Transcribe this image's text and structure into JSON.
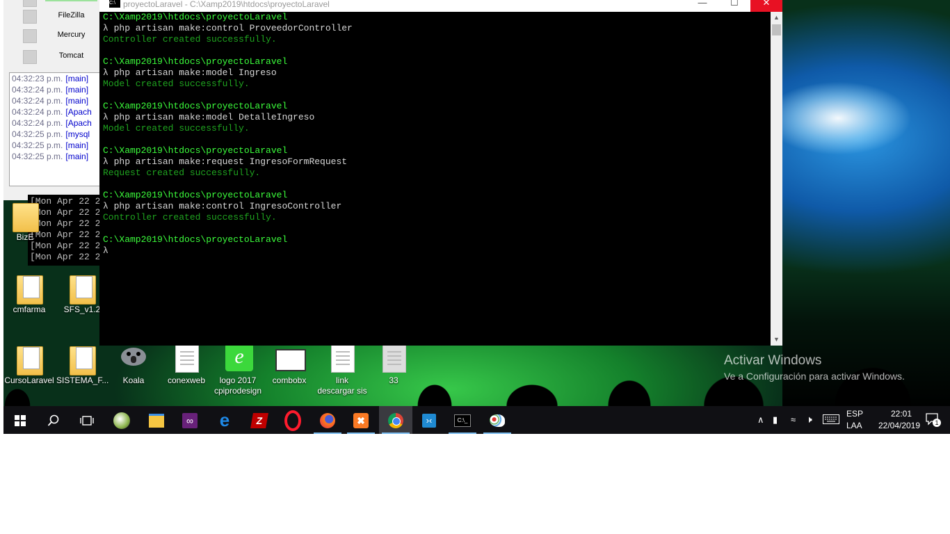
{
  "xampp": {
    "services": [
      "FileZilla",
      "Mercury",
      "Tomcat"
    ],
    "log": [
      {
        "time": "04:32:23 p.m.",
        "tag": "[main]"
      },
      {
        "time": "04:32:24 p.m.",
        "tag": "[main]"
      },
      {
        "time": "04:32:24 p.m.",
        "tag": "[main]"
      },
      {
        "time": "04:32:24 p.m.",
        "tag": "[Apach"
      },
      {
        "time": "04:32:24 p.m.",
        "tag": "[Apach"
      },
      {
        "time": "04:32:25 p.m.",
        "tag": "[mysql"
      },
      {
        "time": "04:32:25 p.m.",
        "tag": "[main]"
      },
      {
        "time": "04:32:25 p.m.",
        "tag": "[main]"
      }
    ]
  },
  "apache_log": [
    "[Mon Apr 22 2",
    "[Mon Apr 22 2",
    "[Mon Apr 22 2",
    "[Mon Apr 22 2",
    "[Mon Apr 22 2",
    "[Mon Apr 22 2"
  ],
  "terminal": {
    "title": "proyectoLaravel -  C:\\Xamp2019\\htdocs\\proyectoLaravel",
    "lines": [
      {
        "kind": "path",
        "text": "C:\\Xamp2019\\htdocs\\proyectoLaravel"
      },
      {
        "kind": "cmd",
        "text": "λ php artisan make:control ProveedorController"
      },
      {
        "kind": "ok",
        "text": "Controller created successfully."
      },
      {
        "kind": "blank",
        "text": ""
      },
      {
        "kind": "path",
        "text": "C:\\Xamp2019\\htdocs\\proyectoLaravel"
      },
      {
        "kind": "cmd",
        "text": "λ php artisan make:model Ingreso"
      },
      {
        "kind": "ok",
        "text": "Model created successfully."
      },
      {
        "kind": "blank",
        "text": ""
      },
      {
        "kind": "path",
        "text": "C:\\Xamp2019\\htdocs\\proyectoLaravel"
      },
      {
        "kind": "cmd",
        "text": "λ php artisan make:model DetalleIngreso"
      },
      {
        "kind": "ok",
        "text": "Model created successfully."
      },
      {
        "kind": "blank",
        "text": ""
      },
      {
        "kind": "path",
        "text": "C:\\Xamp2019\\htdocs\\proyectoLaravel"
      },
      {
        "kind": "cmd",
        "text": "λ php artisan make:request IngresoFormRequest"
      },
      {
        "kind": "ok",
        "text": "Request created successfully."
      },
      {
        "kind": "blank",
        "text": ""
      },
      {
        "kind": "path",
        "text": "C:\\Xamp2019\\htdocs\\proyectoLaravel"
      },
      {
        "kind": "cmd",
        "text": "λ php artisan make:control IngresoController"
      },
      {
        "kind": "ok",
        "text": "Controller created successfully."
      },
      {
        "kind": "blank",
        "text": ""
      },
      {
        "kind": "path",
        "text": "C:\\Xamp2019\\htdocs\\proyectoLaravel"
      },
      {
        "kind": "cmd",
        "text": "λ"
      }
    ]
  },
  "desktop_icons": {
    "bize": "BizE",
    "cmfarma": "cmfarma",
    "sfs": "SFS_v1.2",
    "cursolaravel": "CursoLaravel",
    "sistema": "SISTEMA_F...",
    "koala": "Koala",
    "conexweb": "conexweb",
    "logo": "logo 2017 cpiprodesign",
    "combobx": "combobx",
    "link": "link descargar sis",
    "n33": "33"
  },
  "activation": {
    "title": "Activar Windows",
    "subtitle": "Ve a Configuración para activar Windows."
  },
  "taskbar": {
    "apps": [
      "windows-start",
      "search",
      "task-view",
      "inkscape",
      "file-explorer",
      "visual-studio",
      "edge",
      "filezilla",
      "opera",
      "firefox",
      "xampp",
      "chrome",
      "vscode",
      "cmder",
      "paint"
    ],
    "lang_top": "ESP",
    "lang_bottom": "LAA",
    "time": "22:01",
    "date": "22/04/2019",
    "notification_count": "1"
  }
}
